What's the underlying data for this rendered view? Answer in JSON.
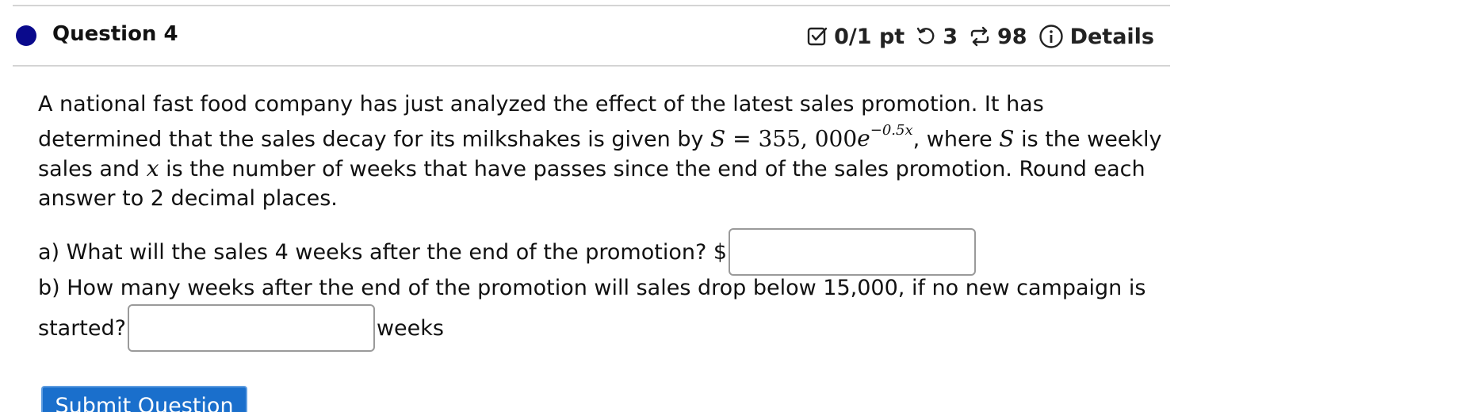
{
  "question": {
    "title": "Question 4",
    "status_color": "#0a0a8c"
  },
  "meta": {
    "points": "0/1 pt",
    "retries": "3",
    "attempts": "98",
    "details_label": "Details"
  },
  "body": {
    "intro_1": "A national fast food company has just analyzed the effect of the latest sales promotion. It has determined that the sales decay for its milkshakes is given by ",
    "formula_lhs": "S",
    "formula_eq": " = 355, 000",
    "formula_base": "e",
    "formula_exp": "−0.5x",
    "intro_2": ", where ",
    "var_s": "S",
    "intro_3": " is the weekly sales and ",
    "var_x": "x",
    "intro_4": " is the number of weeks that have passes since the end of the sales promotion. Round each answer to 2 decimal places."
  },
  "part_a": {
    "label": "a) What will the sales 4 weeks after the end of the promotion? $",
    "value": ""
  },
  "part_b": {
    "label_line1": "b) How many weeks after the end of the promotion will sales drop below 15,000, if no new campaign is",
    "label_line2": "started?",
    "value": "",
    "unit": "weeks"
  },
  "submit_label": "Submit Question",
  "colors": {
    "submit_bg": "#1a6fcc",
    "rule": "#d4d4d4"
  }
}
